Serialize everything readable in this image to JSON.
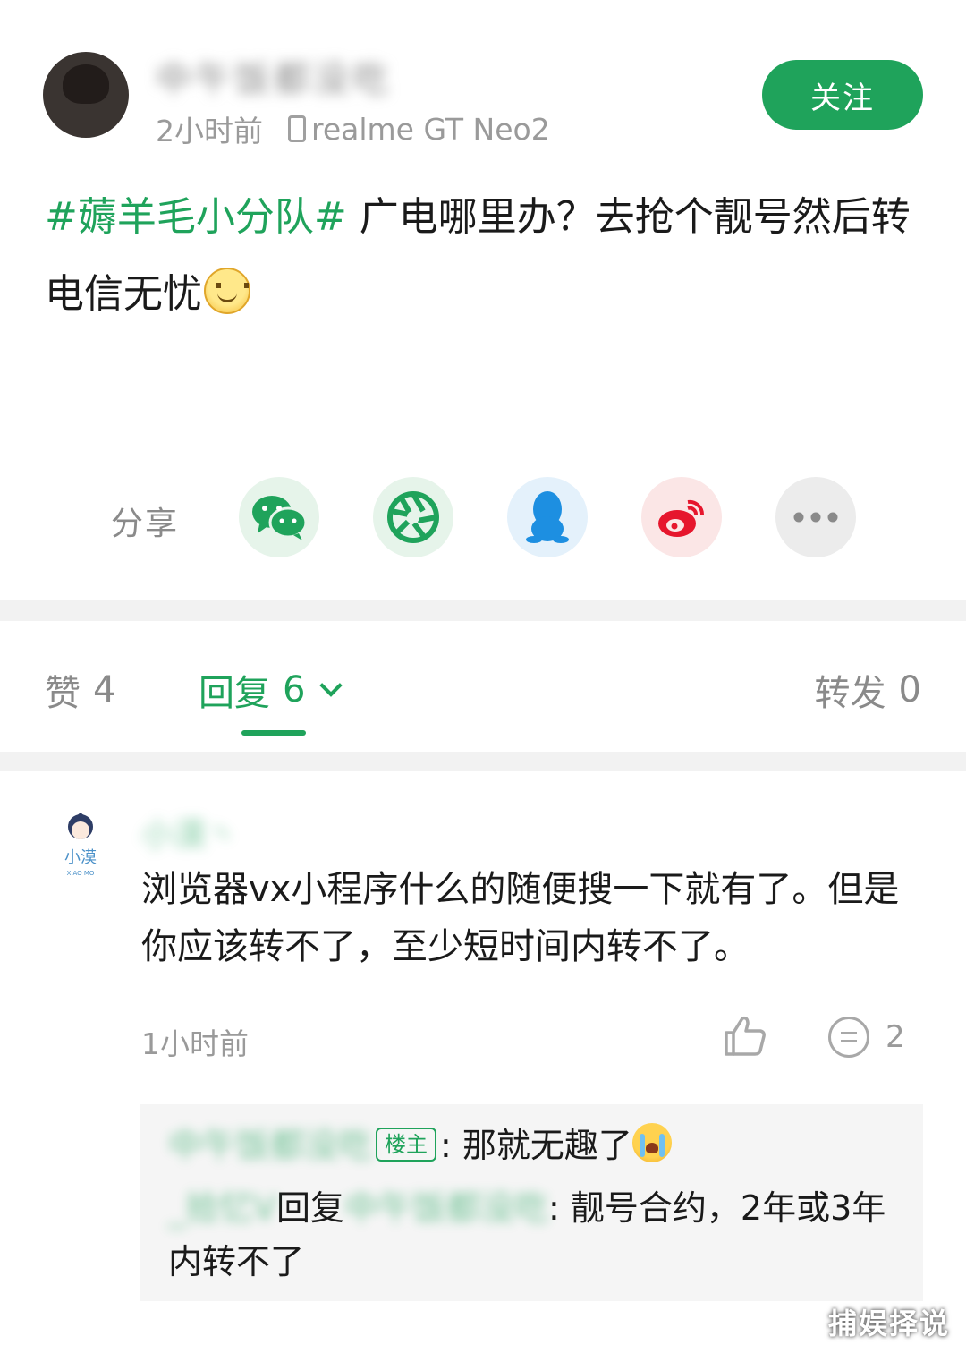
{
  "post": {
    "author_name": "中午饭都没吃",
    "time": "2小时前",
    "device": "realme GT Neo2",
    "follow_label": "关注",
    "topic": "#薅羊毛小分队#",
    "text": " 广电哪里办？去抢个靓号然后转电信无忧",
    "emoji": "smile-emoji"
  },
  "share": {
    "label": "分享",
    "targets": [
      {
        "icon": "wechat-icon",
        "color": "#1fa35b"
      },
      {
        "icon": "moments-icon",
        "color": "#1fa35b"
      },
      {
        "icon": "qq-icon",
        "color": "#1d8fe1"
      },
      {
        "icon": "weibo-icon",
        "color": "#e6162d"
      },
      {
        "icon": "more-icon",
        "color": "#8a8a8a"
      }
    ]
  },
  "stats": {
    "like_label": "赞",
    "like_count": "4",
    "reply_label": "回复",
    "reply_count": "6",
    "forward_label": "转发",
    "forward_count": "0"
  },
  "comment": {
    "author": "小漠丶",
    "avatar_text": "小漠",
    "avatar_sub": "XIAO MO",
    "text": "浏览器vx小程序什么的随便搜一下就有了。但是你应该转不了，至少短时间内转不了。",
    "time": "1小时前",
    "reply_count": "2",
    "sub_replies": [
      {
        "author": "中午饭都没吃",
        "badge": "楼主",
        "text": ": 那就无趣了",
        "emoji": "crying-emoji"
      },
      {
        "author": "_拾忆V",
        "reply_word": "回复",
        "target": "中午饭都没吃",
        "text": ": 靓号合约，2年或3年内转不了"
      }
    ]
  },
  "watermark": "捕娱择说",
  "accent_color": "#1fa35b"
}
